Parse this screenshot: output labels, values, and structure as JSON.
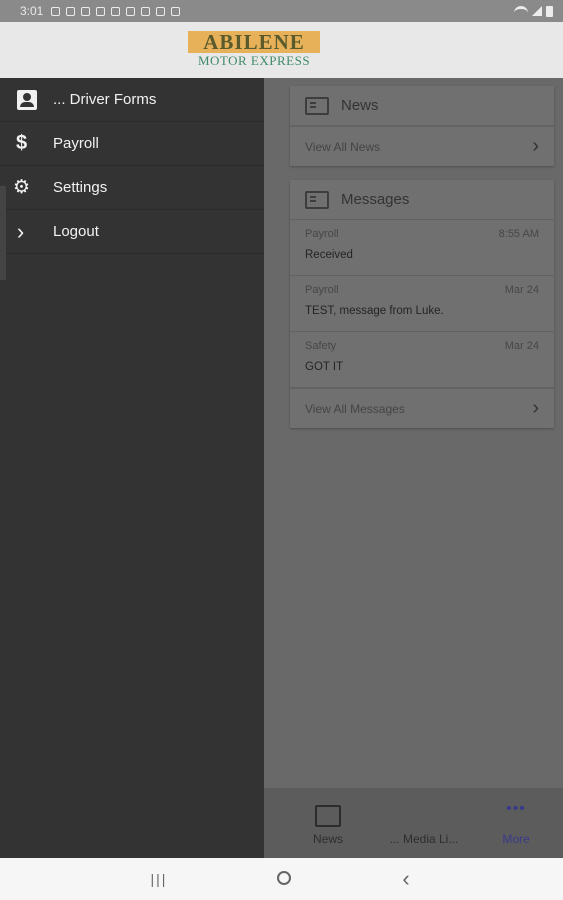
{
  "status_bar": {
    "time": "3:01"
  },
  "header": {
    "logo_line1": "ABILENE",
    "logo_line2": "MOTOR EXPRESS"
  },
  "drawer": {
    "items": [
      {
        "label": "... Driver Forms",
        "icon": "driver-forms-icon"
      },
      {
        "label": "Payroll",
        "icon": "dollar-icon"
      },
      {
        "label": "Settings",
        "icon": "gear-icon"
      },
      {
        "label": "Logout",
        "icon": "chevron-right-icon"
      }
    ]
  },
  "news_card": {
    "title": "News",
    "link": "View All News"
  },
  "messages_card": {
    "title": "Messages",
    "messages": [
      {
        "category": "Payroll",
        "time": "8:55 AM",
        "body": "Received"
      },
      {
        "category": "Payroll",
        "time": "Mar 24",
        "body": "TEST, message from Luke."
      },
      {
        "category": "Safety",
        "time": "Mar 24",
        "body": "GOT IT"
      }
    ],
    "link": "View All Messages"
  },
  "tabbar": {
    "tabs": [
      {
        "label": "News"
      },
      {
        "label": "... Media Li..."
      },
      {
        "label": "More"
      }
    ]
  },
  "colors": {
    "drawer_bg": "#333333",
    "accent_more": "#3a3a8a",
    "logo_gold": "#e6b158",
    "logo_green": "#3f8a6a"
  }
}
